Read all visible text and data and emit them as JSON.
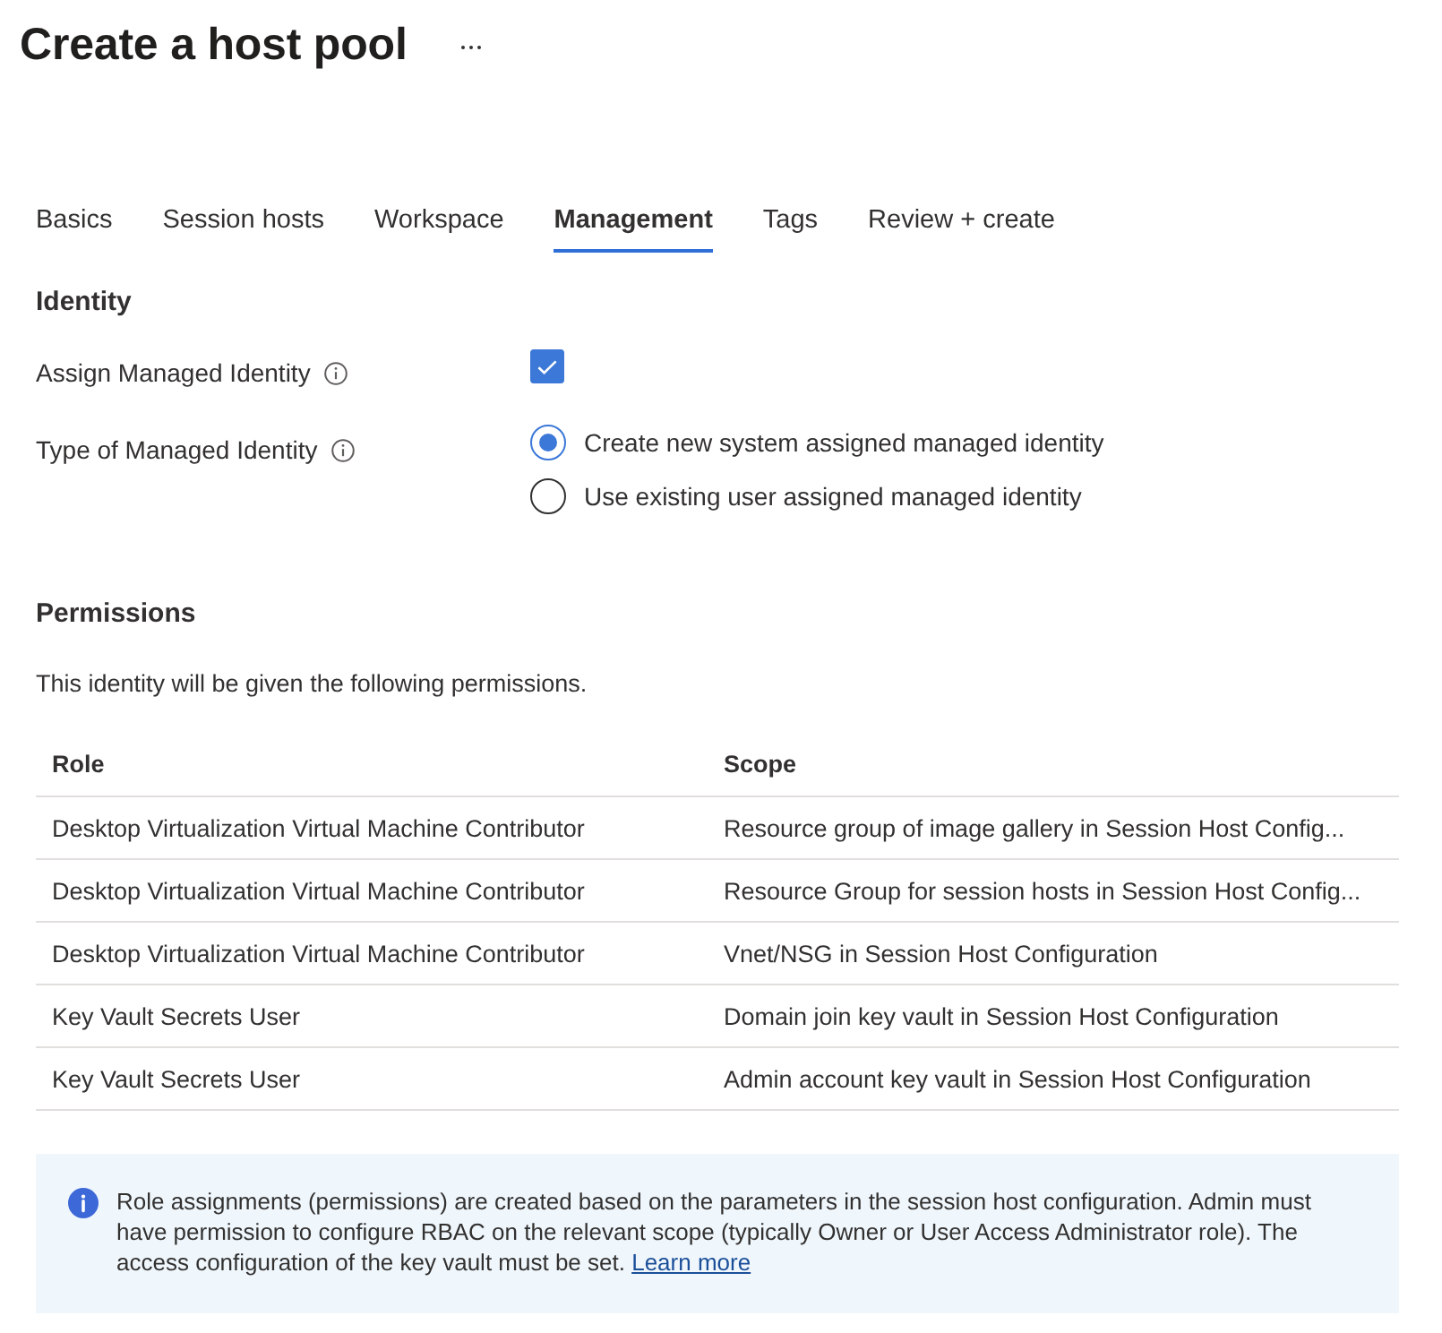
{
  "page": {
    "title": "Create a host pool"
  },
  "tabs": [
    {
      "label": "Basics",
      "selected": false
    },
    {
      "label": "Session hosts",
      "selected": false
    },
    {
      "label": "Workspace",
      "selected": false
    },
    {
      "label": "Management",
      "selected": true
    },
    {
      "label": "Tags",
      "selected": false
    },
    {
      "label": "Review + create",
      "selected": false
    }
  ],
  "identity": {
    "heading": "Identity",
    "fields": [
      {
        "kind": "checkbox",
        "label": "Assign Managed Identity",
        "info": true,
        "checked": true
      },
      {
        "kind": "radio",
        "label": "Type of Managed Identity",
        "info": true,
        "options": [
          {
            "label": "Create new system assigned managed identity",
            "selected": true
          },
          {
            "label": "Use existing user assigned managed identity",
            "selected": false
          }
        ]
      }
    ]
  },
  "permissions": {
    "heading": "Permissions",
    "description": "This identity will be given the following permissions.",
    "table": {
      "columns": [
        "Role",
        "Scope"
      ],
      "rows": [
        [
          "Desktop Virtualization Virtual Machine Contributor",
          "Resource group of image gallery in Session Host Config..."
        ],
        [
          "Desktop Virtualization Virtual Machine Contributor",
          "Resource Group for session hosts in Session Host Config..."
        ],
        [
          "Desktop Virtualization Virtual Machine Contributor",
          "Vnet/NSG in Session Host Configuration"
        ],
        [
          "Key Vault Secrets User",
          "Domain join key vault in Session Host Configuration"
        ],
        [
          "Key Vault Secrets User",
          "Admin account key vault in Session Host Configuration"
        ]
      ]
    }
  },
  "notice": {
    "text": "Role assignments (permissions) are created based on the parameters in the session host configuration. Admin must have permission to configure RBAC on the relevant scope (typically Owner or User Access Administrator role). The access configuration of the key vault must be set.",
    "link": "Learn more"
  }
}
